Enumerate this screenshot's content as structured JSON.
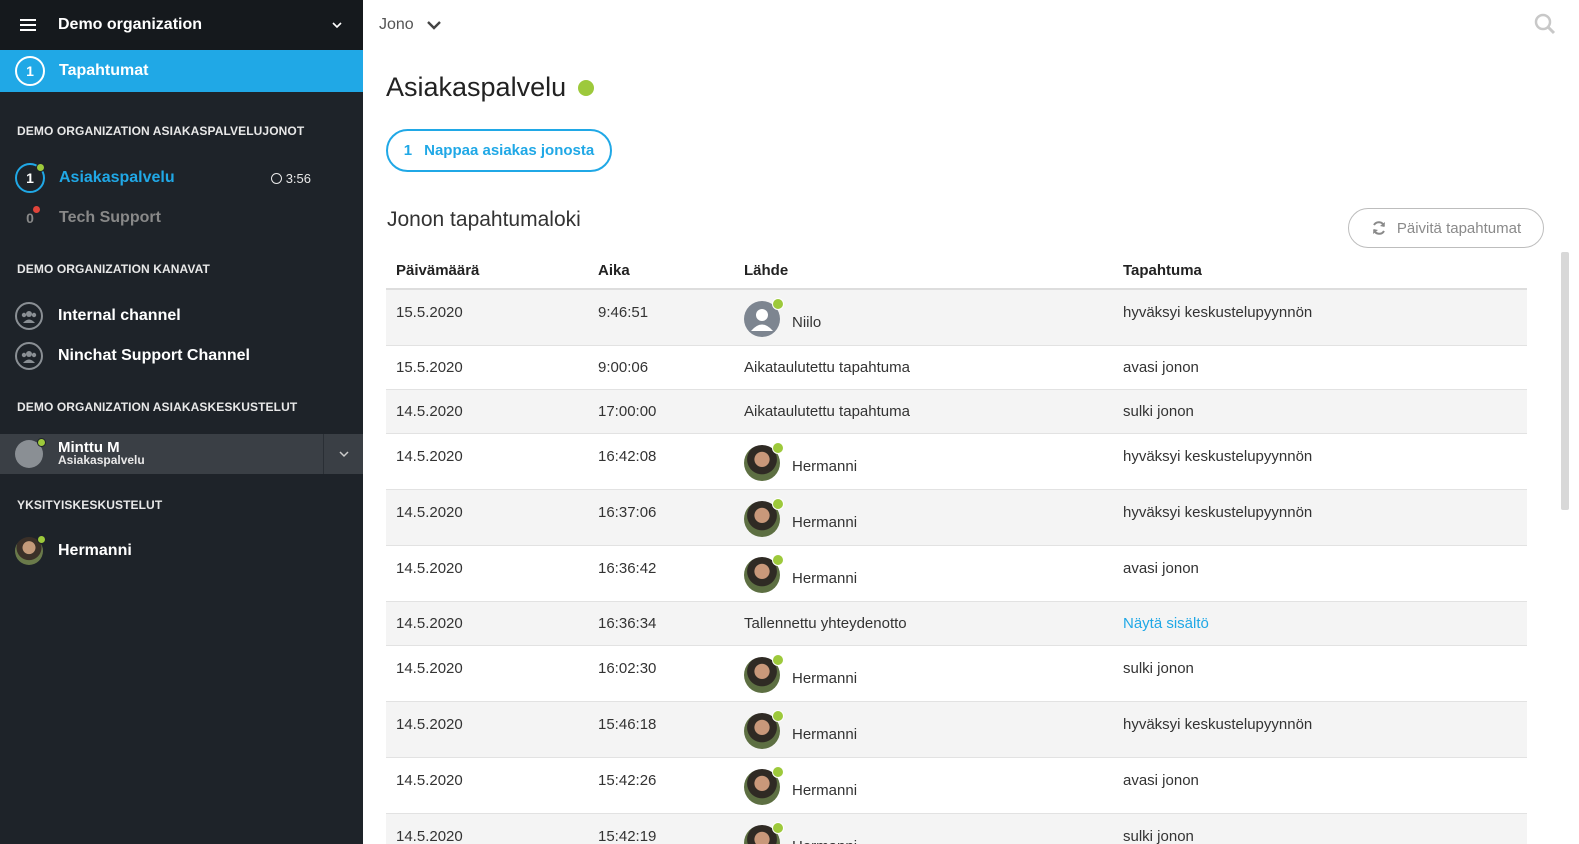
{
  "sidebar": {
    "org_title": "Demo organization",
    "events": {
      "count": "1",
      "label": "Tapahtumat"
    },
    "sections": {
      "queues": "DEMO ORGANIZATION ASIAKASPALVELUJONOT",
      "channels": "DEMO ORGANIZATION KANAVAT",
      "customer_chats": "DEMO ORGANIZATION ASIAKASKESKUSTELUT",
      "private_chats": "YKSITYISKESKUSTELUT"
    },
    "queues": [
      {
        "count": "1",
        "label": "Asiakaspalvelu",
        "timer": "3:56",
        "status_color": "#9dc93b"
      },
      {
        "count": "0",
        "label": "Tech Support",
        "status_color": "#e0443a"
      }
    ],
    "channels": [
      {
        "label": "Internal channel",
        "icon": "group-icon"
      },
      {
        "label": "Ninchat Support Channel",
        "icon": "group-icon"
      }
    ],
    "customer_chat": {
      "name": "Minttu M",
      "queue": "Asiakaspalvelu"
    },
    "private_chat": {
      "name": "Hermanni"
    }
  },
  "topbar": {
    "breadcrumb": "Jono"
  },
  "main": {
    "title": "Asiakaspalvelu",
    "take_button": {
      "count": "1",
      "label": "Nappaa asiakas jonosta"
    },
    "log_title": "Jonon tapahtumaloki",
    "refresh_label": "Päivitä tapahtumat",
    "columns": [
      "Päivämäärä",
      "Aika",
      "Lähde",
      "Tapahtuma"
    ],
    "rows": [
      {
        "date": "15.5.2020",
        "time": "9:46:51",
        "source": "Niilo",
        "avatar": "person",
        "event": "hyväksyi keskustelupyynnön"
      },
      {
        "date": "15.5.2020",
        "time": "9:00:06",
        "source": "Aikataulutettu tapahtuma",
        "avatar": "",
        "event": "avasi jonon"
      },
      {
        "date": "14.5.2020",
        "time": "17:00:00",
        "source": "Aikataulutettu tapahtuma",
        "avatar": "",
        "event": "sulki jonon"
      },
      {
        "date": "14.5.2020",
        "time": "16:42:08",
        "source": "Hermanni",
        "avatar": "photo",
        "event": "hyväksyi keskustelupyynnön"
      },
      {
        "date": "14.5.2020",
        "time": "16:37:06",
        "source": "Hermanni",
        "avatar": "photo",
        "event": "hyväksyi keskustelupyynnön"
      },
      {
        "date": "14.5.2020",
        "time": "16:36:42",
        "source": "Hermanni",
        "avatar": "photo",
        "event": "avasi jonon"
      },
      {
        "date": "14.5.2020",
        "time": "16:36:34",
        "source": "Tallennettu yhteydenotto",
        "avatar": "",
        "event": "Näytä sisältö",
        "event_link": true
      },
      {
        "date": "14.5.2020",
        "time": "16:02:30",
        "source": "Hermanni",
        "avatar": "photo",
        "event": "sulki jonon"
      },
      {
        "date": "14.5.2020",
        "time": "15:46:18",
        "source": "Hermanni",
        "avatar": "photo",
        "event": "hyväksyi keskustelupyynnön"
      },
      {
        "date": "14.5.2020",
        "time": "15:42:26",
        "source": "Hermanni",
        "avatar": "photo",
        "event": "avasi jonon"
      },
      {
        "date": "14.5.2020",
        "time": "15:42:19",
        "source": "Hermanni",
        "avatar": "photo",
        "event": "sulki jonon"
      }
    ]
  },
  "colors": {
    "accent": "#20a8e6",
    "online": "#9dc93b",
    "offline": "#e0443a"
  }
}
